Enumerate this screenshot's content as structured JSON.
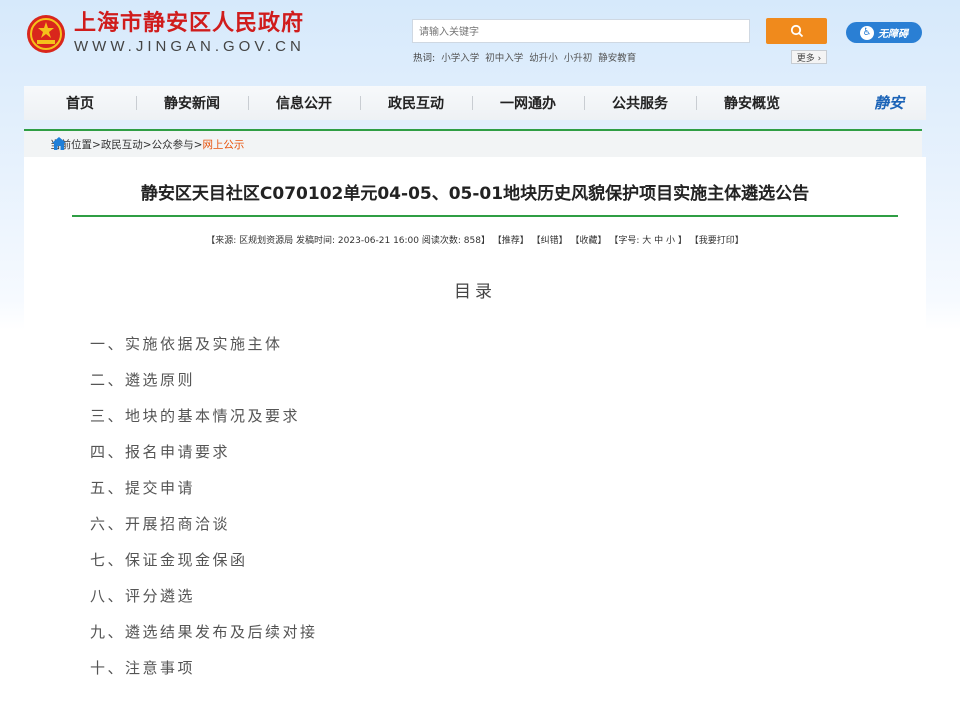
{
  "site": {
    "name_cn": "上海市静安区人民政府",
    "name_en": "WWW.JINGAN.GOV.CN",
    "emblem": "national-emblem-icon"
  },
  "search": {
    "placeholder": "请输入关键字",
    "button_icon": "search-icon",
    "hot_label": "热词:",
    "hot_words": [
      "小学入学",
      "初中入学",
      "幼升小",
      "小升初",
      "静安教育"
    ],
    "more_label": "更多 ›"
  },
  "accessibility": {
    "label": "无障碍",
    "icon": "accessibility-icon"
  },
  "nav": {
    "items": [
      "首页",
      "静安新闻",
      "信息公开",
      "政民互动",
      "一网通办",
      "公共服务",
      "静安概览"
    ],
    "brand": "静安"
  },
  "breadcrumb": {
    "prefix": "当前位置>",
    "items": [
      "政民互动>",
      "公众参与>"
    ],
    "current": "网上公示"
  },
  "article": {
    "title": "静安区天目社区C070102单元04-05、05-01地块历史风貌保护项目实施主体遴选公告",
    "meta": "【来源: 区规划资源局 发稿时间: 2023-06-21 16:00 阅读次数: 858】 【推荐】 【纠错】 【收藏】 【字号: 大 中 小 】 【我要打印】",
    "toc_title": "目录",
    "toc": [
      "一、实施依据及实施主体",
      "二、遴选原则",
      "三、地块的基本情况及要求",
      "四、报名申请要求",
      "五、提交申请",
      "六、开展招商洽谈",
      "七、保证金现金保函",
      "八、评分遴选",
      "九、遴选结果发布及后续对接",
      "十、注意事项"
    ]
  },
  "colors": {
    "brand_red": "#d01c1c",
    "search_orange": "#f08a1c",
    "access_blue": "#2a7fd4",
    "accent_green": "#2f9e44",
    "breadcrumb_current": "#e8540e"
  }
}
